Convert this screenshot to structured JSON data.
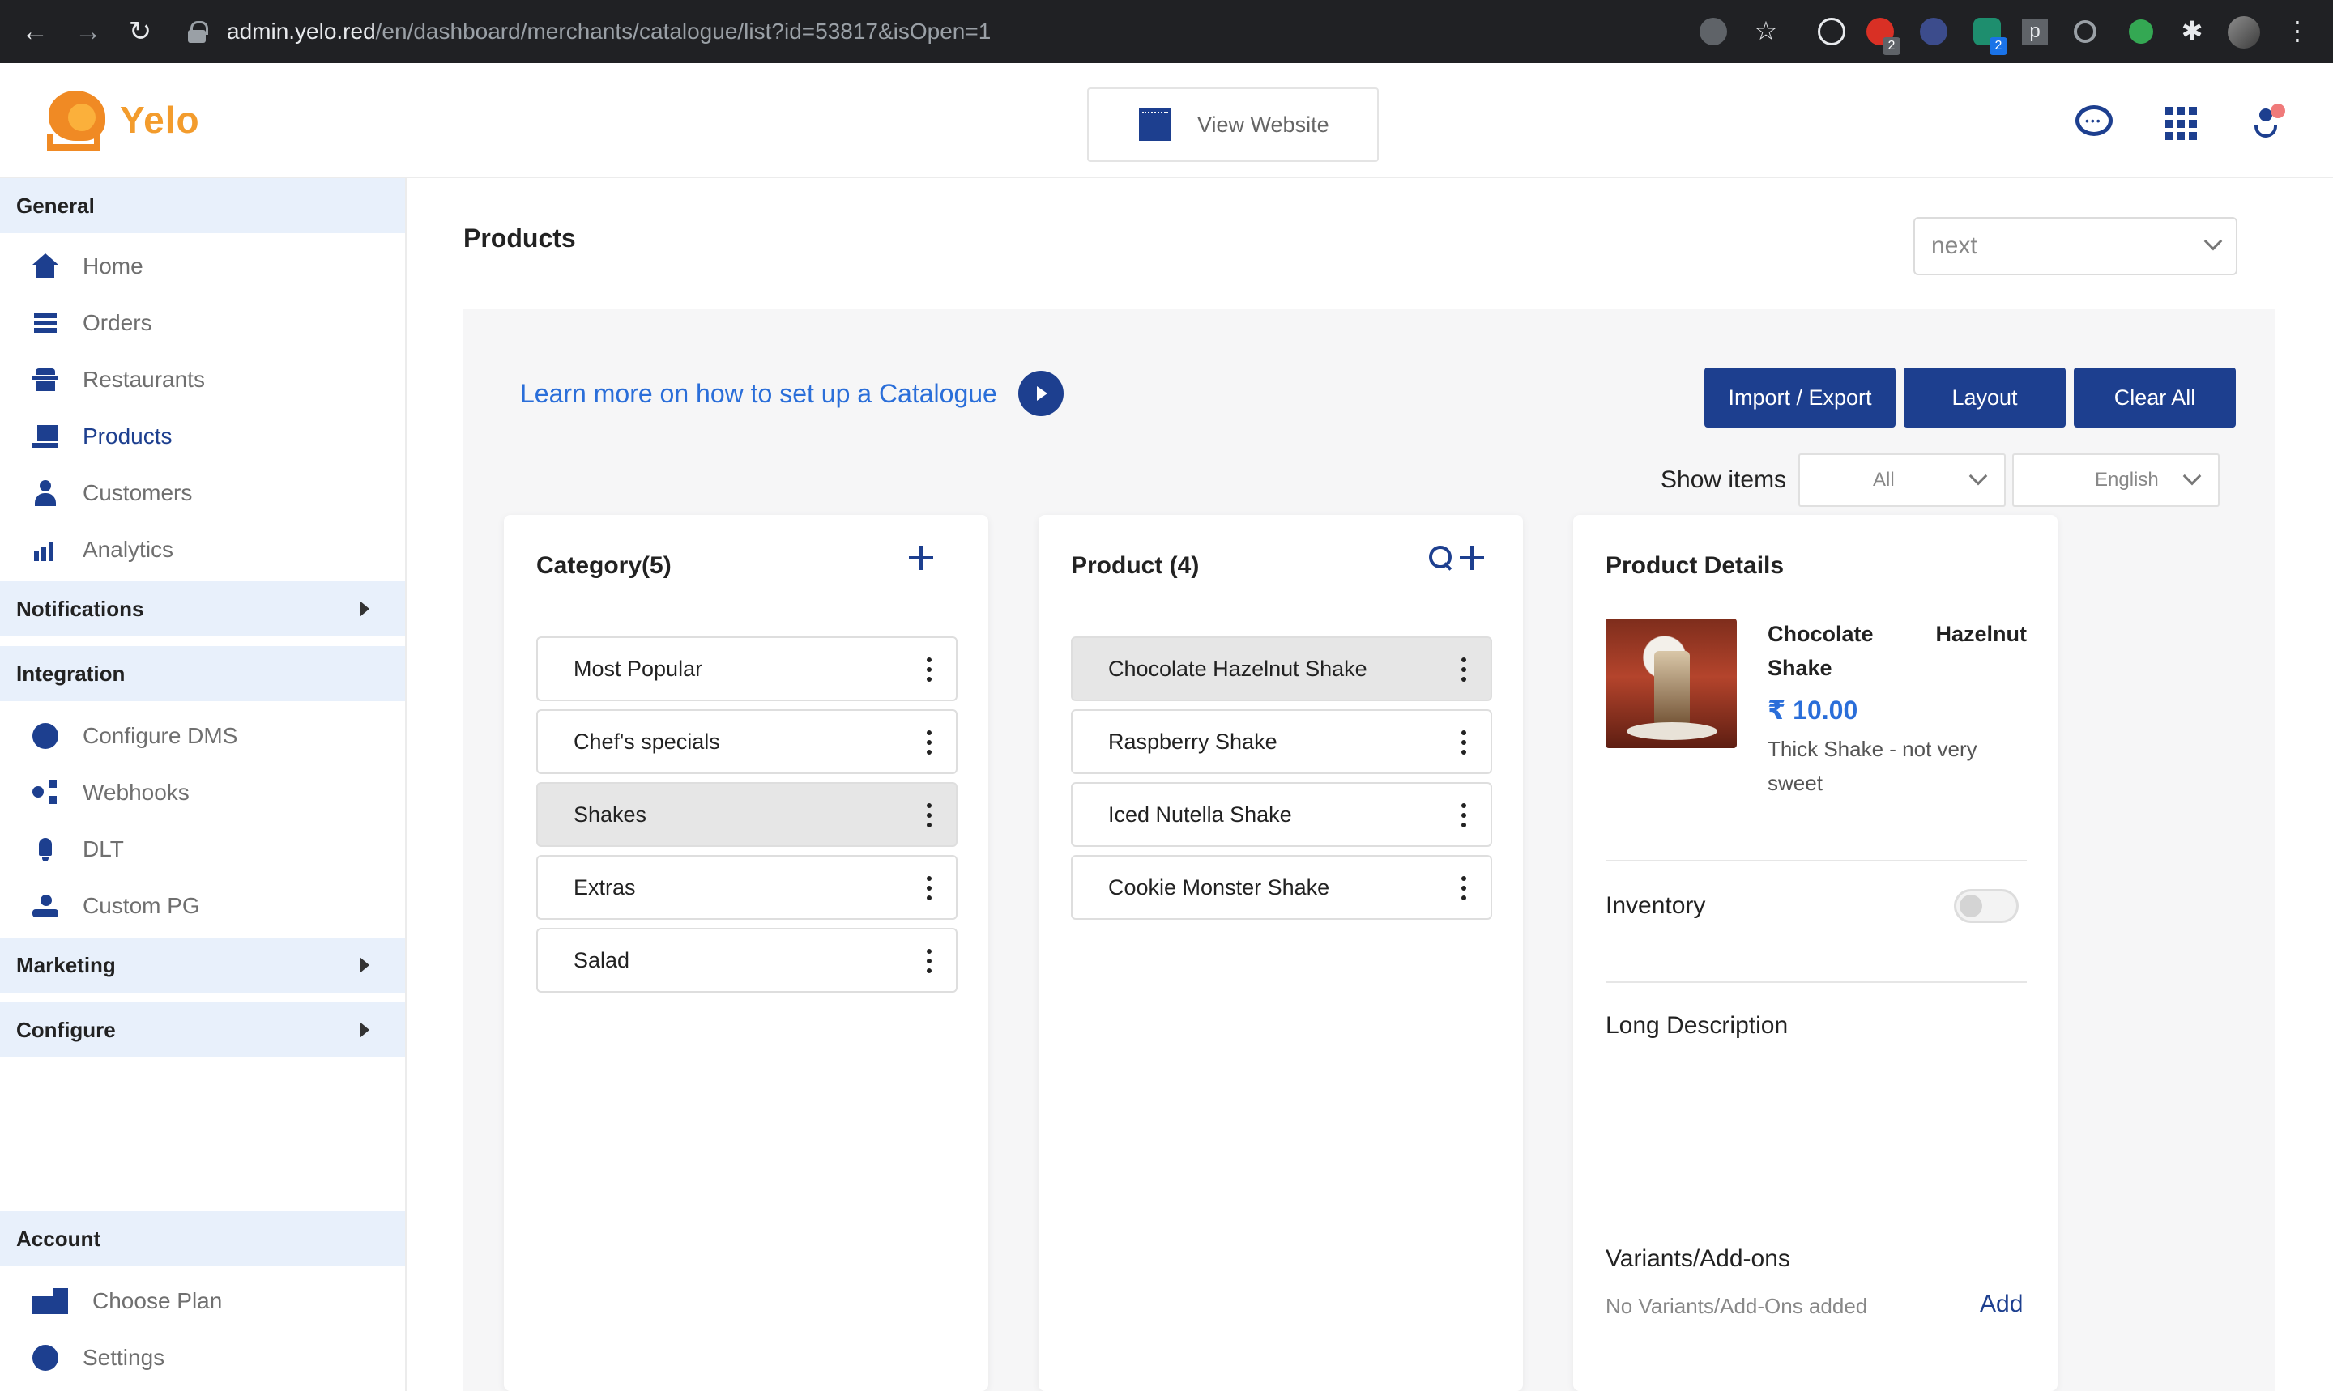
{
  "browser": {
    "url_host": "admin.yelo.red",
    "url_path": "/en/dashboard/merchants/catalogue/list?id=53817&isOpen=1",
    "back_glyph": "←",
    "forward_glyph": "→",
    "reload_glyph": "↻",
    "star_glyph": "☆",
    "puzzle_glyph": "✱",
    "menu_glyph": "⋮",
    "ext_badge_1": "2",
    "ext_badge_2": "2",
    "ext_p": "p"
  },
  "header": {
    "logo_text": "Yelo",
    "view_website_label": "View Website"
  },
  "sidebar": {
    "general": "General",
    "items": [
      {
        "label": "Home",
        "icon": "home-icon"
      },
      {
        "label": "Orders",
        "icon": "orders-icon"
      },
      {
        "label": "Restaurants",
        "icon": "restaurants-icon"
      },
      {
        "label": "Products",
        "icon": "products-icon"
      },
      {
        "label": "Customers",
        "icon": "customers-icon"
      },
      {
        "label": "Analytics",
        "icon": "analytics-icon"
      }
    ],
    "notifications": "Notifications",
    "integration": "Integration",
    "integration_items": [
      {
        "label": "Configure DMS",
        "icon": "mail-icon"
      },
      {
        "label": "Webhooks",
        "icon": "webhooks-icon"
      },
      {
        "label": "DLT",
        "icon": "bell-icon"
      },
      {
        "label": "Custom PG",
        "icon": "payment-icon"
      }
    ],
    "marketing": "Marketing",
    "configure": "Configure",
    "account": "Account",
    "account_items": [
      {
        "label": "Choose Plan",
        "icon": "plan-icon"
      },
      {
        "label": "Settings",
        "icon": "gear-icon"
      }
    ]
  },
  "main": {
    "title": "Products",
    "select_value": "next",
    "learn_more": "Learn more on how to set up a Catalogue",
    "buttons": {
      "import_export": "Import / Export",
      "layout": "Layout",
      "clear_all": "Clear All"
    },
    "show_items_label": "Show items",
    "show_items_value": "All",
    "language_value": "English"
  },
  "category": {
    "title": "Category(5)",
    "items": [
      "Most Popular",
      "Chef's specials",
      "Shakes",
      "Extras",
      "Salad"
    ]
  },
  "product": {
    "title": "Product (4)",
    "items": [
      "Chocolate Hazelnut Shake",
      "Raspberry Shake",
      "Iced Nutella Shake",
      "Cookie Monster Shake"
    ]
  },
  "details": {
    "title": "Product Details",
    "name": "Chocolate Hazelnut Shake",
    "price": "₹ 10.00",
    "description": "Thick Shake - not very sweet",
    "inventory_label": "Inventory",
    "long_description_label": "Long Description",
    "variants_label": "Variants/Add-ons",
    "no_variants": "No Variants/Add-Ons added",
    "add_label": "Add"
  },
  "colors": {
    "primary": "#1d3f8f",
    "link": "#2a6ed9",
    "brand": "#f39c2d",
    "section_bg": "#e8f0fb"
  }
}
